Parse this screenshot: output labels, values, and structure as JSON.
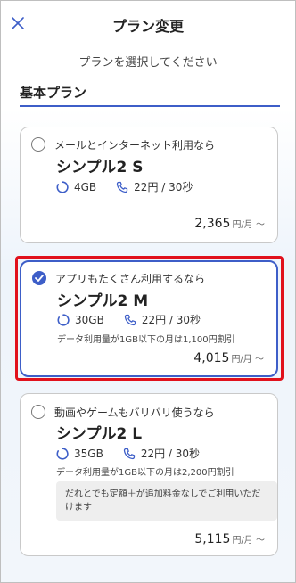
{
  "header": {
    "title": "プラン変更",
    "close_icon": "close-icon"
  },
  "subtitle": "プランを選択してください",
  "section": {
    "title": "基本プラン"
  },
  "colors": {
    "accent": "#3d5ec8",
    "highlight": "#e1111c"
  },
  "plans": [
    {
      "lead": "メールとインターネット利用なら",
      "name": "シンプル2 S",
      "data": "4GB",
      "call": "22円 / 30秒",
      "price": "2,365",
      "unit": "円/月 〜",
      "selected": false
    },
    {
      "lead": "アプリもたくさん利用するなら",
      "name": "シンプル2 M",
      "data": "30GB",
      "call": "22円 / 30秒",
      "note": "データ利用量が1GB以下の月は1,100円割引",
      "price": "4,015",
      "unit": "円/月 〜",
      "selected": true
    },
    {
      "lead": "動画やゲームもバリバリ使うなら",
      "name": "シンプル2 L",
      "data": "35GB",
      "call": "22円 / 30秒",
      "note": "データ利用量が1GB以下の月は2,200円割引",
      "box": "だれとでも定額＋が追加料金なしでご利用いただけます",
      "price": "5,115",
      "unit": "円/月 〜",
      "selected": false
    }
  ]
}
